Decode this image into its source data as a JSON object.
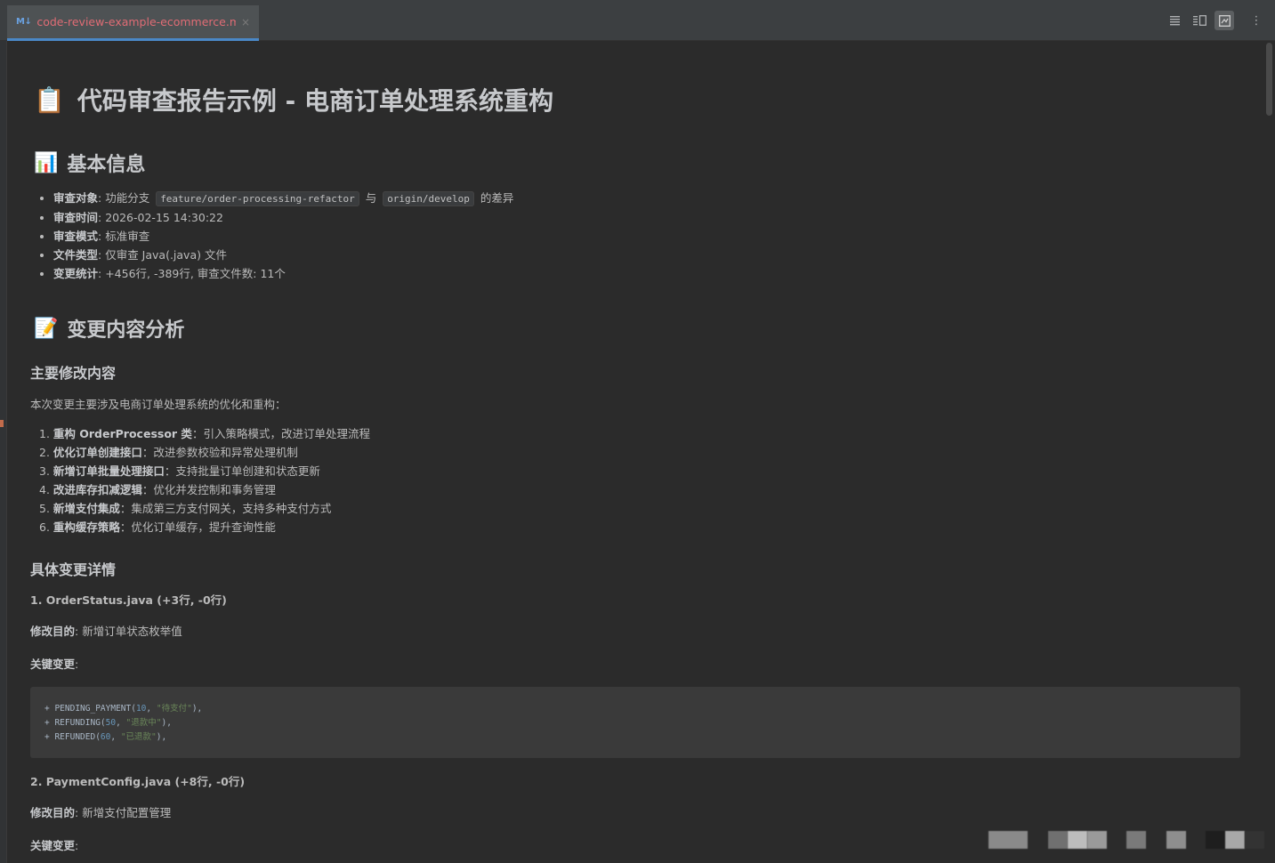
{
  "tab": {
    "icon_label": "M↓",
    "title": "code-review-example-ecommerce.md",
    "close": "×"
  },
  "toolbar": {
    "more": "⋮"
  },
  "doc": {
    "h1_emoji": "📋",
    "title": "代码审查报告示例 - 电商订单处理系统重构",
    "basic": {
      "emoji": "📊",
      "heading": "基本信息",
      "items": [
        {
          "label": "审查对象",
          "pre": ": 功能分支 ",
          "code1": "feature/order-processing-refactor",
          "mid": " 与 ",
          "code2": "origin/develop",
          "post": " 的差异"
        },
        {
          "label": "审查时间",
          "text": ": 2026-02-15 14:30:22"
        },
        {
          "label": "审查模式",
          "text": ": 标准审查"
        },
        {
          "label": "文件类型",
          "text": ": 仅审查 Java(.java) 文件"
        },
        {
          "label": "变更统计",
          "text": ": +456行, -389行, 审查文件数: 11个"
        }
      ]
    },
    "analysis": {
      "emoji": "📝",
      "heading": "变更内容分析",
      "main_changes_heading": "主要修改内容",
      "intro": "本次变更主要涉及电商订单处理系统的优化和重构：",
      "changes": [
        {
          "num": "1. ",
          "label": "重构 OrderProcessor 类",
          "text": "：引入策略模式，改进订单处理流程"
        },
        {
          "num": "2. ",
          "label": "优化订单创建接口",
          "text": "：改进参数校验和异常处理机制"
        },
        {
          "num": "3. ",
          "label": "新增订单批量处理接口",
          "text": "：支持批量订单创建和状态更新"
        },
        {
          "num": "4. ",
          "label": "改进库存扣减逻辑",
          "text": "：优化并发控制和事务管理"
        },
        {
          "num": "5. ",
          "label": "新增支付集成",
          "text": "：集成第三方支付网关，支持多种支付方式"
        },
        {
          "num": "6. ",
          "label": "重构缓存策略",
          "text": "：优化订单缓存，提升查询性能"
        }
      ],
      "details_heading": "具体变更详情",
      "file1": {
        "title": "1. OrderStatus.java (+3行, -0行)",
        "purpose_label": "修改目的",
        "purpose_text": ": 新增订单状态枚举值",
        "key_label": "关键变更",
        "key_colon": ":",
        "code": [
          {
            "pre": "+ PENDING_PAYMENT(",
            "num": "10",
            "sep": ", ",
            "str": "\"待支付\"",
            "post": "),"
          },
          {
            "pre": "+ REFUNDING(",
            "num": "50",
            "sep": ", ",
            "str": "\"退款中\"",
            "post": "),"
          },
          {
            "pre": "+ REFUNDED(",
            "num": "60",
            "sep": ", ",
            "str": "\"已退款\"",
            "post": "),"
          }
        ]
      },
      "file2": {
        "title": "2. PaymentConfig.java (+8行, -0行)",
        "purpose_label": "修改目的",
        "purpose_text": ": 新增支付配置管理",
        "key_label": "关键变更",
        "key_colon": ":"
      }
    }
  },
  "colors": {
    "background": "#2b2b2b",
    "tab_underline": "#4a88c7",
    "tab_title": "#e06c75"
  }
}
